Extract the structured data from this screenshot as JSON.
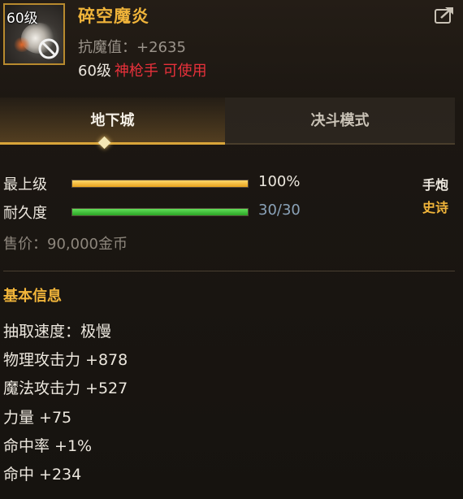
{
  "item": {
    "level_badge": "60级",
    "name": "碎空魔炎",
    "resist": "抗魔值：+2635",
    "req_level": "60级",
    "req_class": "神枪手 可使用",
    "icon": "flame-item-icon",
    "share_icon": "share-icon"
  },
  "tabs": {
    "dungeon": "地下城",
    "duel": "决斗模式",
    "active": "dungeon"
  },
  "grade": {
    "label": "最上级",
    "value_text": "100%",
    "value": 1.0
  },
  "durability": {
    "label": "耐久度",
    "value_text": "30/30",
    "value": 1.0
  },
  "weapon_type": "手炮",
  "rarity": "史诗",
  "price": "售价：90,000金币",
  "section_title": "基本信息",
  "stats": [
    "抽取速度：极慢",
    "物理攻击力 +878",
    "魔法攻击力 +527",
    "力量 +75",
    "命中率 +1%",
    "命中 +234"
  ],
  "colors": {
    "gold": "#f0b43a",
    "red": "#e8313b",
    "grade_bar": "#e7a21d",
    "dura_bar": "#2aa324"
  }
}
